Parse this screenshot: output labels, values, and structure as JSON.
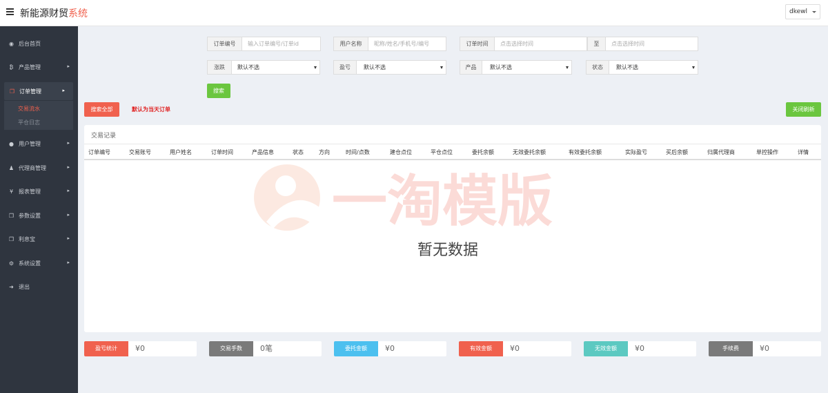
{
  "app": {
    "title_main": "新能源财贸",
    "title_accent": "系统",
    "user": "dkewl"
  },
  "sidebar": {
    "items": [
      {
        "label": "后台首页",
        "icon": "dashboard-icon",
        "glyph": "◉"
      },
      {
        "label": "产品管理",
        "icon": "bitcoin-icon",
        "glyph": "₿"
      },
      {
        "label": "订单管理",
        "icon": "copy-icon",
        "glyph": "❐"
      },
      {
        "label": "用户管理",
        "icon": "user-icon",
        "glyph": "●"
      },
      {
        "label": "代理商管理",
        "icon": "users-icon",
        "glyph": "♟"
      },
      {
        "label": "报表管理",
        "icon": "yen-icon",
        "glyph": "¥"
      },
      {
        "label": "参数设置",
        "icon": "files-icon",
        "glyph": "❐"
      },
      {
        "label": "利息宝",
        "icon": "files-icon",
        "glyph": "❐"
      },
      {
        "label": "系统设置",
        "icon": "gears-icon",
        "glyph": "⚙"
      },
      {
        "label": "退出",
        "icon": "logout-icon",
        "glyph": "➜"
      }
    ],
    "submenu": [
      {
        "label": "交易流水"
      },
      {
        "label": "平仓日志"
      }
    ]
  },
  "search": {
    "order_no": {
      "label": "订单编号",
      "placeholder": "输入订单编号/订单id"
    },
    "username": {
      "label": "用户名称",
      "placeholder": "昵称/姓名/手机号/编号"
    },
    "order_time": {
      "label": "订单时间",
      "placeholder_start": "点击选择时间",
      "to": "至",
      "placeholder_end": "点击选择时间"
    },
    "rise_fall": {
      "label": "涨跌",
      "value": "默认不选"
    },
    "profit_loss": {
      "label": "盈亏",
      "value": "默认不选"
    },
    "product": {
      "label": "产品",
      "value": "默认不选"
    },
    "status": {
      "label": "状态",
      "value": "默认不选"
    },
    "search_btn": "搜索",
    "search_all_btn": "搜索全部",
    "default_note": "默认为当天订单",
    "refresh_btn": "关闭刷新"
  },
  "table": {
    "title": "交易记录",
    "columns": [
      "订单编号",
      "交易账号",
      "用户姓名",
      "订单时间",
      "产品信息",
      "状态",
      "方向",
      "时间/点数",
      "建仓点位",
      "平仓点位",
      "委托余额",
      "无效委托余额",
      "有效委托余额",
      "实际盈亏",
      "买后余额",
      "归属代理商",
      "单控操作",
      "详情"
    ],
    "empty_text": "暂无数据",
    "watermark": "一淘模版"
  },
  "stats": [
    {
      "label": "盈亏统计",
      "value": "¥0",
      "color": "#f0614e"
    },
    {
      "label": "交易手数",
      "value": "0笔",
      "color": "#7a7a7a"
    },
    {
      "label": "委托金额",
      "value": "¥0",
      "color": "#4cc0ef"
    },
    {
      "label": "有效金额",
      "value": "¥0",
      "color": "#f0614e"
    },
    {
      "label": "无效金额",
      "value": "¥0",
      "color": "#5cc9c1"
    },
    {
      "label": "手续费",
      "value": "¥0",
      "color": "#7a7a7a"
    }
  ]
}
